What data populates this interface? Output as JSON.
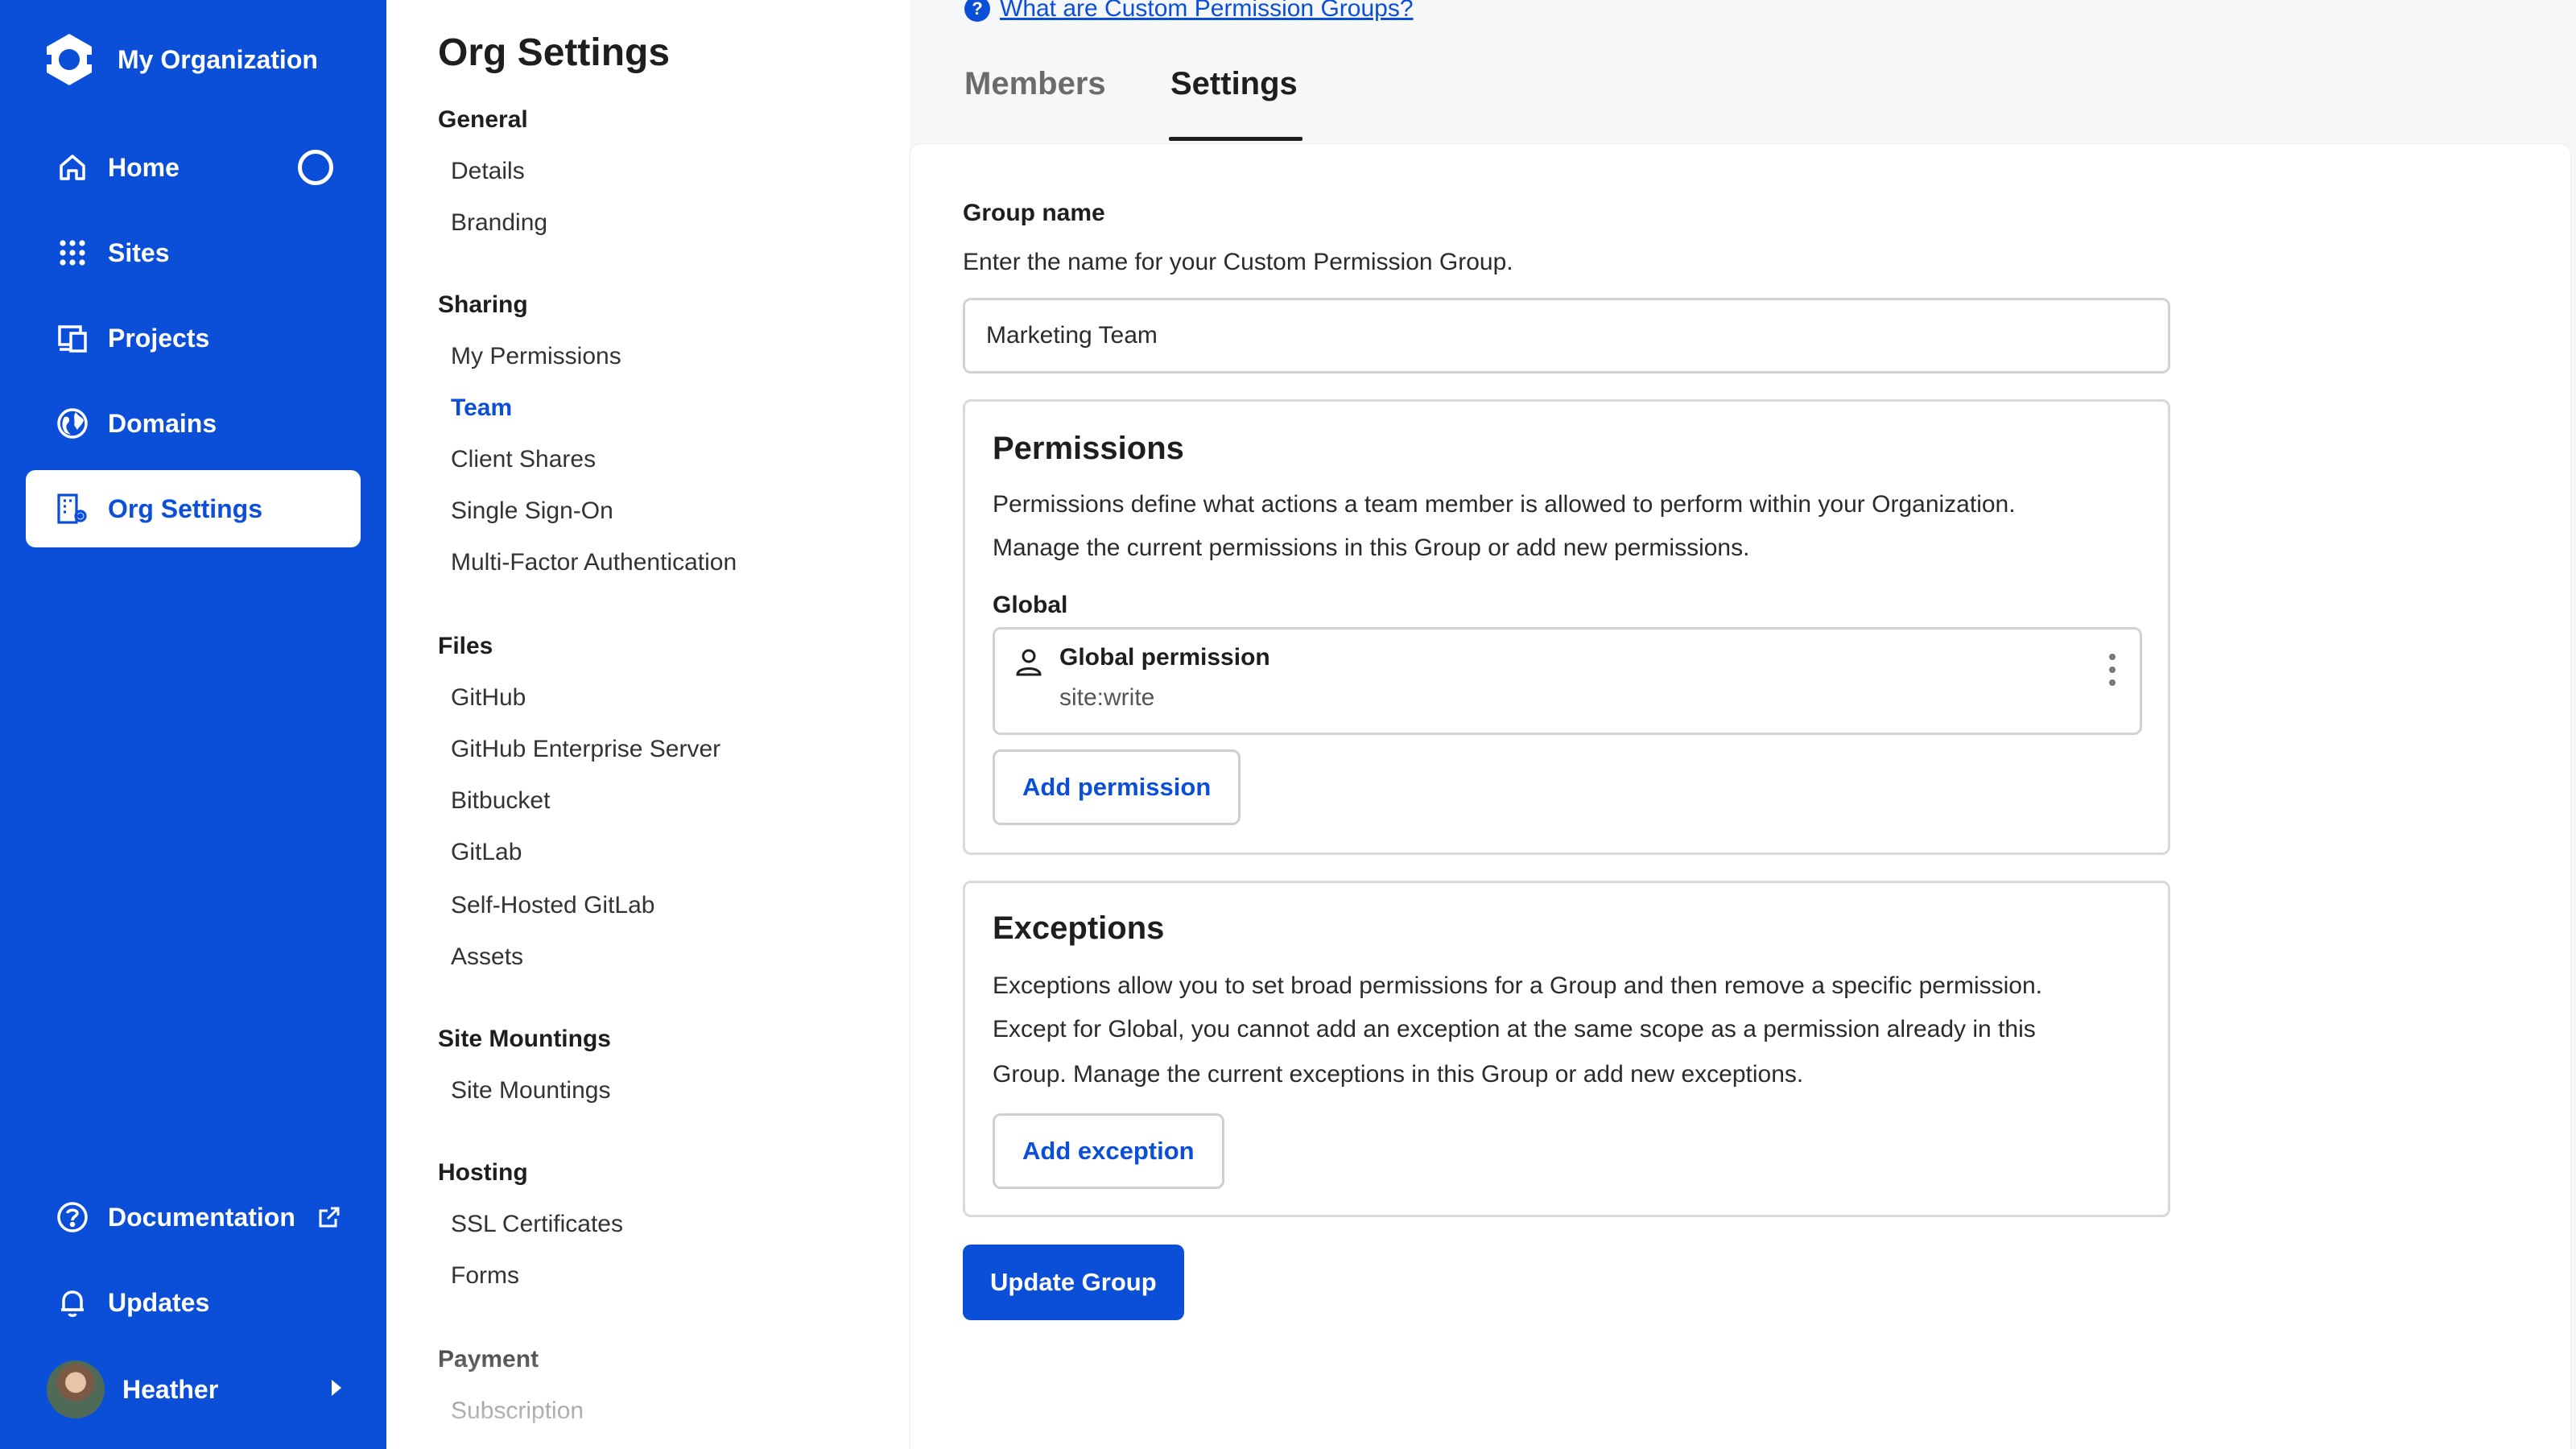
{
  "app": {
    "org_name": "My Organization"
  },
  "nav": {
    "items": [
      {
        "label": "Home",
        "icon": "home-icon"
      },
      {
        "label": "Sites",
        "icon": "grid-icon"
      },
      {
        "label": "Projects",
        "icon": "projects-icon"
      },
      {
        "label": "Domains",
        "icon": "globe-icon"
      },
      {
        "label": "Org Settings",
        "icon": "org-settings-icon",
        "active": true
      }
    ],
    "bottom": [
      {
        "label": "Documentation",
        "icon": "help-circle-icon"
      },
      {
        "label": "Updates",
        "icon": "bell-icon"
      }
    ],
    "user": {
      "name": "Heather"
    },
    "accent_color": "#0b4fd9"
  },
  "subnav": {
    "title": "Org Settings",
    "groups": [
      {
        "label": "General",
        "items": [
          "Details",
          "Branding"
        ]
      },
      {
        "label": "Sharing",
        "items": [
          "My Permissions",
          "Team",
          "Client Shares",
          "Single Sign-On",
          "Multi-Factor Authentication"
        ]
      },
      {
        "label": "Files",
        "items": [
          "GitHub",
          "GitHub Enterprise Server",
          "Bitbucket",
          "GitLab",
          "Self-Hosted GitLab",
          "Assets"
        ]
      },
      {
        "label": "Site Mountings",
        "items": [
          "Site Mountings"
        ]
      },
      {
        "label": "Hosting",
        "items": [
          "SSL Certificates",
          "Forms"
        ]
      },
      {
        "label": "Payment",
        "items": [
          "Subscription"
        ]
      }
    ],
    "active_item": "Team"
  },
  "main": {
    "help_link": "What are Custom Permission Groups?",
    "tabs": [
      {
        "label": "Members",
        "active": false
      },
      {
        "label": "Settings",
        "active": true
      }
    ],
    "group_name": {
      "label": "Group name",
      "description": "Enter the name for your Custom Permission Group.",
      "value": "Marketing Team"
    },
    "permissions": {
      "title": "Permissions",
      "description_line1": "Permissions define what actions a team member is allowed to perform within your Organization.",
      "description_line2": "Manage the current permissions in this Group or add new permissions.",
      "section_label": "Global",
      "items": [
        {
          "name": "Global permission",
          "scope": "site:write"
        }
      ],
      "add_button": "Add permission"
    },
    "exceptions": {
      "title": "Exceptions",
      "description_line1": "Exceptions allow you to set broad permissions for a Group and then remove a specific permission.",
      "description_line2": "Except for Global, you cannot add an exception at the same scope as a permission already in this",
      "description_line3": "Group. Manage the current exceptions in this Group or add new exceptions.",
      "add_button": "Add exception"
    },
    "submit_button": "Update Group"
  }
}
